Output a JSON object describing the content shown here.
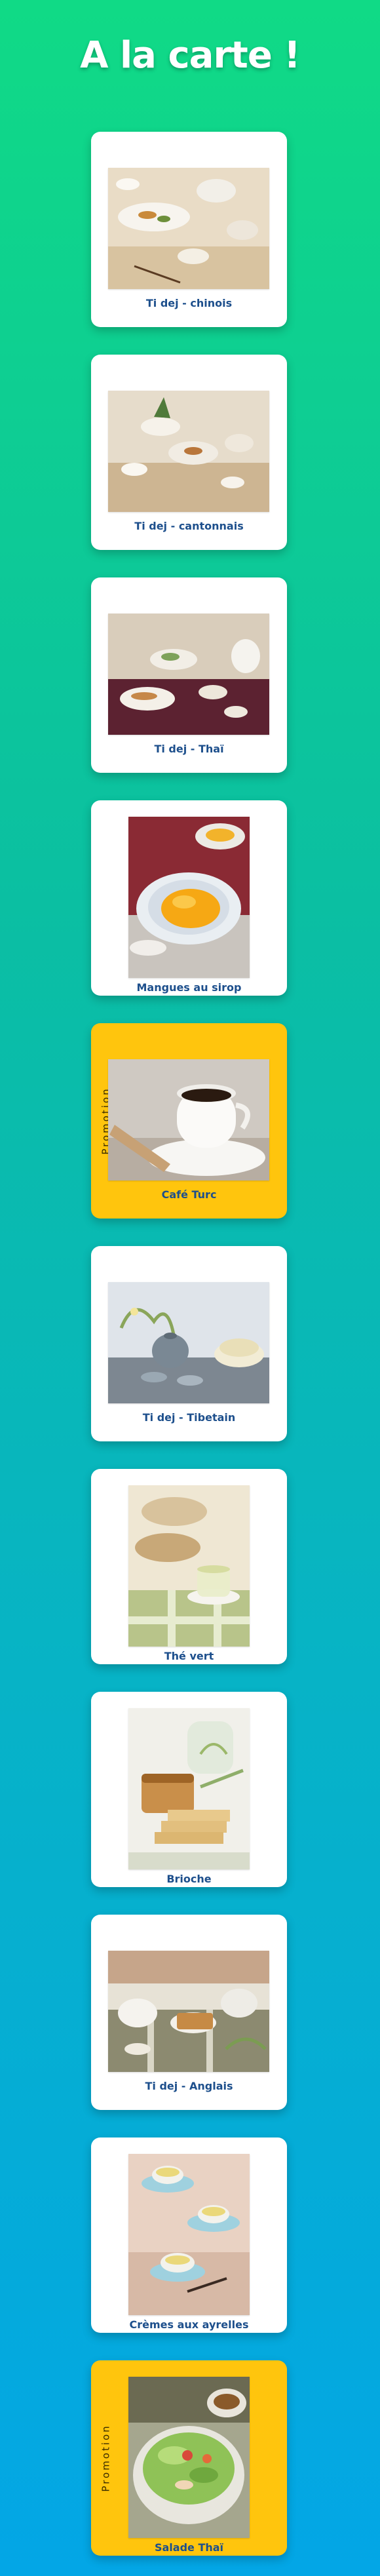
{
  "header": {
    "title": "A la carte !"
  },
  "promo_label": "Promotion",
  "colors": {
    "gradient_top": "#10da86",
    "gradient_bottom": "#03a6e6",
    "card": "#ffffff",
    "promo_card": "#ffc50d",
    "caption": "#1d4f8c"
  },
  "menu": {
    "items": [
      {
        "label": "Ti dej - chinois",
        "promo": false,
        "photo": "chinese-breakfast-table"
      },
      {
        "label": "Ti dej - cantonnais",
        "promo": false,
        "photo": "cantonese-breakfast-table"
      },
      {
        "label": "Ti dej - Thaï",
        "promo": false,
        "photo": "thai-breakfast-table"
      },
      {
        "label": "Mangues au sirop",
        "promo": false,
        "photo": "mango-syrup-bowl"
      },
      {
        "label": "Café Turc",
        "promo": true,
        "photo": "turkish-coffee-cup"
      },
      {
        "label": "Ti dej - Tibetain",
        "promo": false,
        "photo": "tibetan-tea-set"
      },
      {
        "label": "Thé vert",
        "promo": false,
        "photo": "green-tea-glass"
      },
      {
        "label": "Brioche",
        "promo": false,
        "photo": "brioche-loaf"
      },
      {
        "label": "Ti dej - Anglais",
        "promo": false,
        "photo": "english-breakfast-table"
      },
      {
        "label": "Crèmes aux ayrelles",
        "promo": false,
        "photo": "cream-cups"
      },
      {
        "label": "Salade Thaï",
        "promo": true,
        "photo": "thai-salad-bowl"
      }
    ]
  }
}
